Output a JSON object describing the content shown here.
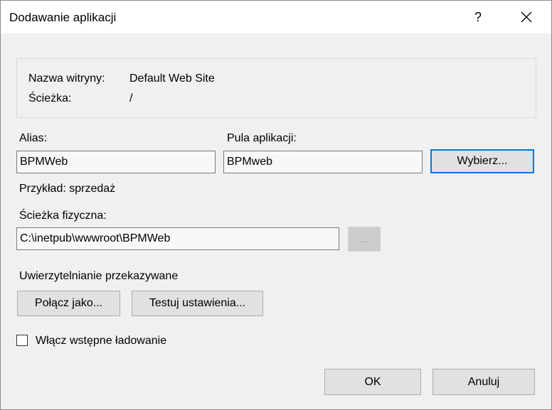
{
  "window": {
    "title": "Dodawanie aplikacji",
    "help_label": "?",
    "close_icon": "close-icon"
  },
  "site_info": {
    "site_name_label": "Nazwa witryny:",
    "site_name_value": "Default Web Site",
    "path_label": "Ścieżka:",
    "path_value": "/"
  },
  "alias": {
    "label": "Alias:",
    "value": "BPMWeb",
    "example": "Przykład: sprzedaż"
  },
  "app_pool": {
    "label": "Pula aplikacji:",
    "value": "BPMweb",
    "select_button": "Wybierz..."
  },
  "physical_path": {
    "label": "Ścieżka fizyczna:",
    "value": "C:\\inetpub\\wwwroot\\BPMWeb",
    "browse_button": "..."
  },
  "pass_through": {
    "label": "Uwierzytelnianie przekazywane",
    "connect_as_button": "Połącz jako...",
    "test_settings_button": "Testuj ustawienia..."
  },
  "preload": {
    "label": "Włącz wstępne ładowanie",
    "checked": false
  },
  "footer": {
    "ok_button": "OK",
    "cancel_button": "Anuluj"
  },
  "colors": {
    "focus_border": "#0078d7",
    "dialog_background": "#f0f0f0"
  }
}
